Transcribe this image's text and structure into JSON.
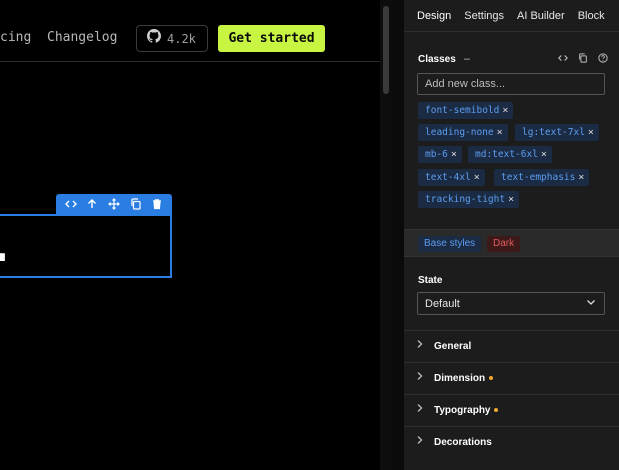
{
  "canvas": {
    "nav": {
      "pricing_fragment": "cing",
      "changelog": "Changelog",
      "github_count": "4.2k",
      "cta": "Get started"
    },
    "selected_text_fragment": "."
  },
  "toolbar_icons": [
    "code-icon",
    "arrow-up-icon",
    "move-icon",
    "duplicate-icon",
    "delete-icon"
  ],
  "panel": {
    "tabs": [
      {
        "label": "Design"
      },
      {
        "label": "Settings"
      },
      {
        "label": "AI Builder"
      },
      {
        "label": "Block"
      }
    ],
    "classes": {
      "title": "Classes",
      "dash": "–",
      "input_placeholder": "Add new class...",
      "chips": [
        "font-semibold",
        "leading-none",
        "lg:text-7xl",
        "mb-6",
        "md:text-6xl",
        "text-4xl",
        "text-emphasis",
        "tracking-tight"
      ]
    },
    "badges": {
      "base": "Base styles",
      "dark": "Dark"
    },
    "state": {
      "label": "State",
      "value": "Default"
    },
    "sections": [
      {
        "title": "General",
        "modified": false
      },
      {
        "title": "Dimension",
        "modified": true
      },
      {
        "title": "Typography",
        "modified": true
      },
      {
        "title": "Decorations",
        "modified": false
      }
    ],
    "colors": {
      "accent": "#2a7de1",
      "cta": "#c8f542",
      "modified_dot": "#f0a830",
      "chip_text": "#5c9df0"
    }
  }
}
